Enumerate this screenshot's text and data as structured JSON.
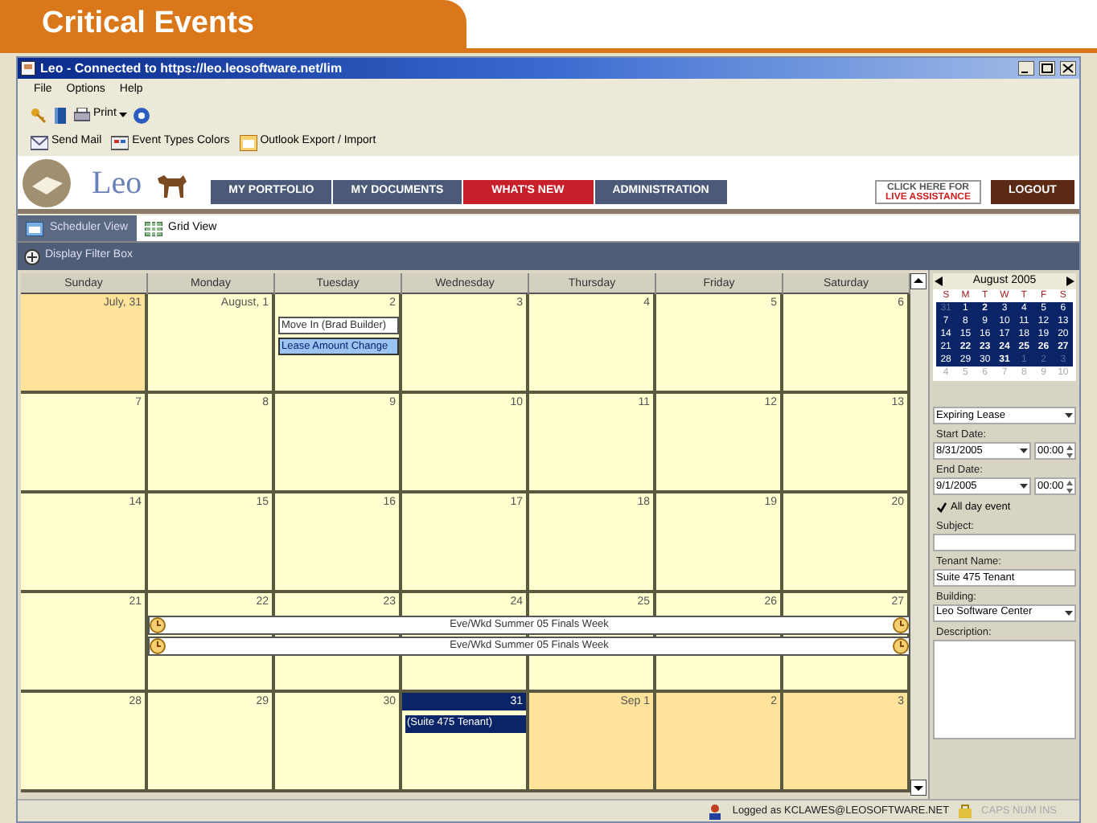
{
  "slide_title": "Critical Events",
  "window": {
    "title": "Leo - Connected to https://leo.leosoftware.net/lim"
  },
  "menu": [
    "File",
    "Options",
    "Help"
  ],
  "toolbar": [
    {
      "label": "Print"
    }
  ],
  "toolbar2": [
    "Send Mail",
    "Event Types Colors",
    "Outlook Export / Import"
  ],
  "logo": "Leo",
  "nav": [
    {
      "label": "MY PORTFOLIO",
      "selected": false
    },
    {
      "label": "MY DOCUMENTS",
      "selected": false
    },
    {
      "label": "WHAT'S NEW",
      "selected": true
    },
    {
      "label": "ADMINISTRATION",
      "selected": false
    }
  ],
  "assist": [
    "CLICK HERE FOR",
    "LIVE ASSISTANCE"
  ],
  "logout": "LOGOUT",
  "tabs": [
    {
      "label": "Scheduler View",
      "selected": true
    },
    {
      "label": "Grid View",
      "selected": false
    }
  ],
  "filter_bar": "Display Filter Box",
  "calendar": {
    "columns": [
      "Sunday",
      "Monday",
      "Tuesday",
      "Wednesday",
      "Thursday",
      "Friday",
      "Saturday"
    ],
    "weeks": [
      {
        "days": [
          {
            "label": "July, 31",
            "other_month": true,
            "selected": false
          },
          {
            "label": "August, 1",
            "other_month": false,
            "selected": false
          },
          {
            "label": "2",
            "other_month": false,
            "selected": false,
            "events": [
              {
                "label": "Move In (Brad Builder)",
                "kind": "plain"
              },
              {
                "label": "Lease Amount Change",
                "kind": "highlighted"
              }
            ]
          },
          {
            "label": "3",
            "other_month": false,
            "selected": false
          },
          {
            "label": "4",
            "other_month": false,
            "selected": false
          },
          {
            "label": "5",
            "other_month": false,
            "selected": false
          },
          {
            "label": "6",
            "other_month": false,
            "selected": false
          }
        ]
      },
      {
        "days": [
          {
            "label": "7",
            "other_month": false,
            "selected": false
          },
          {
            "label": "8",
            "other_month": false,
            "selected": false
          },
          {
            "label": "9",
            "other_month": false,
            "selected": false
          },
          {
            "label": "10",
            "other_month": false,
            "selected": false
          },
          {
            "label": "11",
            "other_month": false,
            "selected": false
          },
          {
            "label": "12",
            "other_month": false,
            "selected": false
          },
          {
            "label": "13",
            "other_month": false,
            "selected": false
          }
        ]
      },
      {
        "days": [
          {
            "label": "14",
            "other_month": false,
            "selected": false
          },
          {
            "label": "15",
            "other_month": false,
            "selected": false
          },
          {
            "label": "16",
            "other_month": false,
            "selected": false
          },
          {
            "label": "17",
            "other_month": false,
            "selected": false
          },
          {
            "label": "18",
            "other_month": false,
            "selected": false
          },
          {
            "label": "19",
            "other_month": false,
            "selected": false
          },
          {
            "label": "20",
            "other_month": false,
            "selected": false
          }
        ]
      },
      {
        "days": [
          {
            "label": "21",
            "other_month": false,
            "selected": false
          },
          {
            "label": "22",
            "other_month": false,
            "selected": false,
            "events": [
              {
                "label": "Eve/Wkd Summer 05 Finals Week",
                "kind": "week_span"
              },
              {
                "label": "Eve/Wkd Summer 05 Finals Week",
                "kind": "week_span"
              }
            ]
          },
          {
            "label": "23",
            "other_month": false,
            "selected": false
          },
          {
            "label": "24",
            "other_month": false,
            "selected": false
          },
          {
            "label": "25",
            "other_month": false,
            "selected": false
          },
          {
            "label": "26",
            "other_month": false,
            "selected": false
          },
          {
            "label": "27",
            "other_month": false,
            "selected": false
          }
        ]
      },
      {
        "days": [
          {
            "label": "28",
            "other_month": false,
            "selected": false
          },
          {
            "label": "29",
            "other_month": false,
            "selected": false
          },
          {
            "label": "30",
            "other_month": false,
            "selected": false
          },
          {
            "label": "31",
            "other_month": false,
            "selected": true,
            "events": [
              {
                "label": "(Suite 475 Tenant)",
                "kind": "dark"
              }
            ]
          },
          {
            "label": "Sep 1",
            "other_month": true,
            "selected": false
          },
          {
            "label": "2",
            "other_month": true,
            "selected": false
          },
          {
            "label": "3",
            "other_month": true,
            "selected": false
          }
        ]
      }
    ]
  },
  "mini_calendar": {
    "title": "August 2005",
    "weekdays": [
      "S",
      "M",
      "T",
      "W",
      "T",
      "F",
      "S"
    ],
    "weeks": [
      {
        "in_range": true,
        "days": [
          {
            "d": "31",
            "bold": false,
            "other": true
          },
          {
            "d": "1",
            "bold": false,
            "other": false
          },
          {
            "d": "2",
            "bold": true,
            "other": false
          },
          {
            "d": "3",
            "bold": false,
            "other": false
          },
          {
            "d": "4",
            "bold": false,
            "other": false
          },
          {
            "d": "5",
            "bold": false,
            "other": false
          },
          {
            "d": "6",
            "bold": false,
            "other": false
          }
        ]
      },
      {
        "in_range": true,
        "days": [
          {
            "d": "7",
            "bold": false,
            "other": false
          },
          {
            "d": "8",
            "bold": false,
            "other": false
          },
          {
            "d": "9",
            "bold": false,
            "other": false
          },
          {
            "d": "10",
            "bold": false,
            "other": false
          },
          {
            "d": "11",
            "bold": false,
            "other": false
          },
          {
            "d": "12",
            "bold": false,
            "other": false
          },
          {
            "d": "13",
            "bold": false,
            "other": false
          }
        ]
      },
      {
        "in_range": true,
        "days": [
          {
            "d": "14",
            "bold": false,
            "other": false
          },
          {
            "d": "15",
            "bold": false,
            "other": false
          },
          {
            "d": "16",
            "bold": false,
            "other": false
          },
          {
            "d": "17",
            "bold": false,
            "other": false
          },
          {
            "d": "18",
            "bold": false,
            "other": false
          },
          {
            "d": "19",
            "bold": false,
            "other": false
          },
          {
            "d": "20",
            "bold": false,
            "other": false
          }
        ]
      },
      {
        "in_range": true,
        "days": [
          {
            "d": "21",
            "bold": false,
            "other": false
          },
          {
            "d": "22",
            "bold": true,
            "other": false
          },
          {
            "d": "23",
            "bold": true,
            "other": false
          },
          {
            "d": "24",
            "bold": true,
            "other": false
          },
          {
            "d": "25",
            "bold": true,
            "other": false
          },
          {
            "d": "26",
            "bold": true,
            "other": false
          },
          {
            "d": "27",
            "bold": true,
            "other": false
          }
        ]
      },
      {
        "in_range": true,
        "days": [
          {
            "d": "28",
            "bold": false,
            "other": false
          },
          {
            "d": "29",
            "bold": false,
            "other": false
          },
          {
            "d": "30",
            "bold": false,
            "other": false
          },
          {
            "d": "31",
            "bold": true,
            "other": false
          },
          {
            "d": "1",
            "bold": false,
            "other": true
          },
          {
            "d": "2",
            "bold": false,
            "other": true
          },
          {
            "d": "3",
            "bold": false,
            "other": true
          }
        ]
      },
      {
        "in_range": false,
        "days": [
          {
            "d": "4",
            "bold": false,
            "other": true
          },
          {
            "d": "5",
            "bold": false,
            "other": true
          },
          {
            "d": "6",
            "bold": false,
            "other": true
          },
          {
            "d": "7",
            "bold": false,
            "other": true
          },
          {
            "d": "8",
            "bold": false,
            "other": true
          },
          {
            "d": "9",
            "bold": false,
            "other": true
          },
          {
            "d": "10",
            "bold": false,
            "other": true
          }
        ]
      }
    ]
  },
  "event_form": {
    "event_type": "Expiring Lease",
    "start_label": "Start Date:",
    "start_date": "8/31/2005",
    "start_time": "00:00",
    "end_label": "End Date:",
    "end_date": "9/1/2005",
    "end_time": "00:00",
    "all_day_label": "All day event",
    "all_day": true,
    "subject_label": "Subject:",
    "tenant_label": "Tenant Name:",
    "tenant": "Suite 475 Tenant",
    "building_label": "Building:",
    "building": "Leo Software Center",
    "description_label": "Description:"
  },
  "status_bar": {
    "user": "Logged as KCLAWES@LEOSOFTWARE.NET",
    "indicators": "CAPS NUM INS"
  }
}
